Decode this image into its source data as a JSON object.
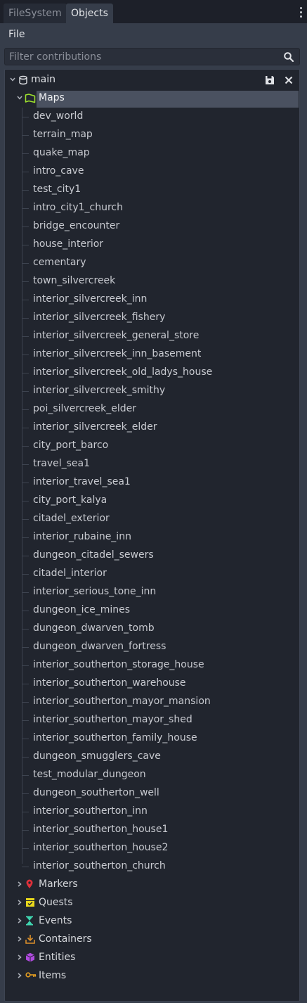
{
  "tabs": [
    {
      "label": "FileSystem",
      "active": false
    },
    {
      "label": "Objects",
      "active": true
    }
  ],
  "menu": {
    "file_label": "File"
  },
  "filter": {
    "placeholder": "Filter contributions",
    "value": ""
  },
  "tree": {
    "root": {
      "label": "main",
      "icon": "database-icon",
      "expanded": true
    },
    "maps": {
      "label": "Maps",
      "icon": "map-icon",
      "expanded": true,
      "items": [
        "dev_world",
        "terrain_map",
        "quake_map",
        "intro_cave",
        "test_city1",
        "intro_city1_church",
        "bridge_encounter",
        "house_interior",
        "cementary",
        "town_silvercreek",
        "interior_silvercreek_inn",
        "interior_silvercreek_fishery",
        "interior_silvercreek_general_store",
        "interior_silvercreek_inn_basement",
        "interior_silvercreek_old_ladys_house",
        "interior_silvercreek_smithy",
        "poi_silvercreek_elder",
        "interior_silvercreek_elder",
        "city_port_barco",
        "travel_sea1",
        "interior_travel_sea1",
        "city_port_kalya",
        "citadel_exterior",
        "interior_rubaine_inn",
        "dungeon_citadel_sewers",
        "citadel_interior",
        "interior_serious_tone_inn",
        "dungeon_ice_mines",
        "dungeon_dwarven_tomb",
        "dungeon_dwarven_fortress",
        "interior_southerton_storage_house",
        "interior_southerton_warehouse",
        "interior_southerton_mayor_mansion",
        "interior_southerton_mayor_shed",
        "interior_southerton_family_house",
        "dungeon_smugglers_cave",
        "test_modular_dungeon",
        "dungeon_southerton_well",
        "interior_southerton_inn",
        "interior_southerton_house1",
        "interior_southerton_house2",
        "interior_southerton_church"
      ]
    },
    "categories": [
      {
        "label": "Markers",
        "icon": "marker-icon",
        "color": "#e0303a"
      },
      {
        "label": "Quests",
        "icon": "quest-icon",
        "color": "#e8d81c"
      },
      {
        "label": "Events",
        "icon": "hourglass-icon",
        "color": "#3fd6b0"
      },
      {
        "label": "Containers",
        "icon": "container-icon",
        "color": "#e0922a"
      },
      {
        "label": "Entities",
        "icon": "cube-icon",
        "color": "#b04adf"
      },
      {
        "label": "Items",
        "icon": "key-icon",
        "color": "#e8a020"
      }
    ]
  },
  "colors": {
    "panel_bg": "#363d4a",
    "tree_bg": "#21252e",
    "selection": "#4a5160",
    "map_icon": "#9ee22e"
  }
}
